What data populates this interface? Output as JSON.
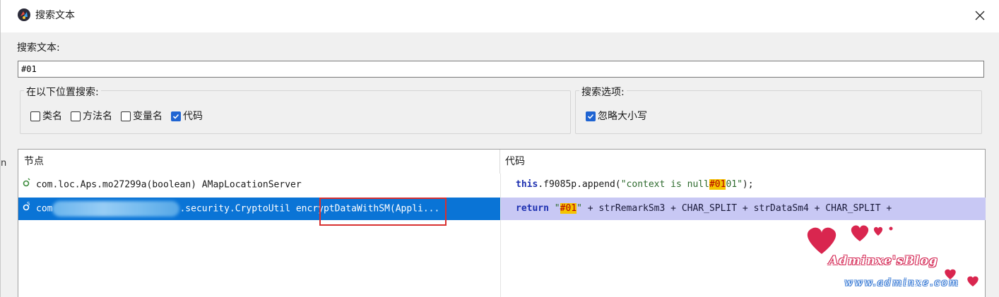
{
  "window": {
    "title": "搜索文本",
    "close_symbol": "✕"
  },
  "search": {
    "label": "搜索文本:",
    "value": "#01"
  },
  "search_scope": {
    "title": "在以下位置搜索:",
    "options": [
      {
        "label": "类名",
        "checked": false
      },
      {
        "label": "方法名",
        "checked": false
      },
      {
        "label": "变量名",
        "checked": false
      },
      {
        "label": "代码",
        "checked": true
      }
    ]
  },
  "search_options": {
    "title": "搜索选项:",
    "options": [
      {
        "label": "忽略大小写",
        "checked": true
      }
    ]
  },
  "results": {
    "columns": {
      "node": "节点",
      "code": "代码"
    },
    "rows": [
      {
        "node": "com.loc.Aps.mo27299a(boolean) AMapLocationServer",
        "code_kw": "this",
        "code_a": ".f9085p.append(",
        "code_str_before": "\"context is null",
        "code_match": "#01",
        "code_str_after": "01\"",
        "code_b": ");"
      },
      {
        "node_prefix": "com",
        "node_middle": ".security.CryptoUtil encryptDataWithSM(Appli...",
        "code_kw": "return",
        "code_str_open": "\"",
        "code_match": "#01",
        "code_str_close": "\"",
        "code_rest": " + strRemarkSm3 + CHAR_SPLIT + strDataSm4 + CHAR_SPLIT +"
      }
    ]
  },
  "side_text": "n",
  "watermark": {
    "name": "Adminxe'sBlog",
    "url": "www.adminxe.com"
  },
  "colors": {
    "selection_blue": "#0a74d6",
    "code_selection": "#c8c8f4",
    "match_highlight": "#f5c400",
    "annotation_red": "#d83030",
    "checkbox_blue": "#1f64d2"
  }
}
